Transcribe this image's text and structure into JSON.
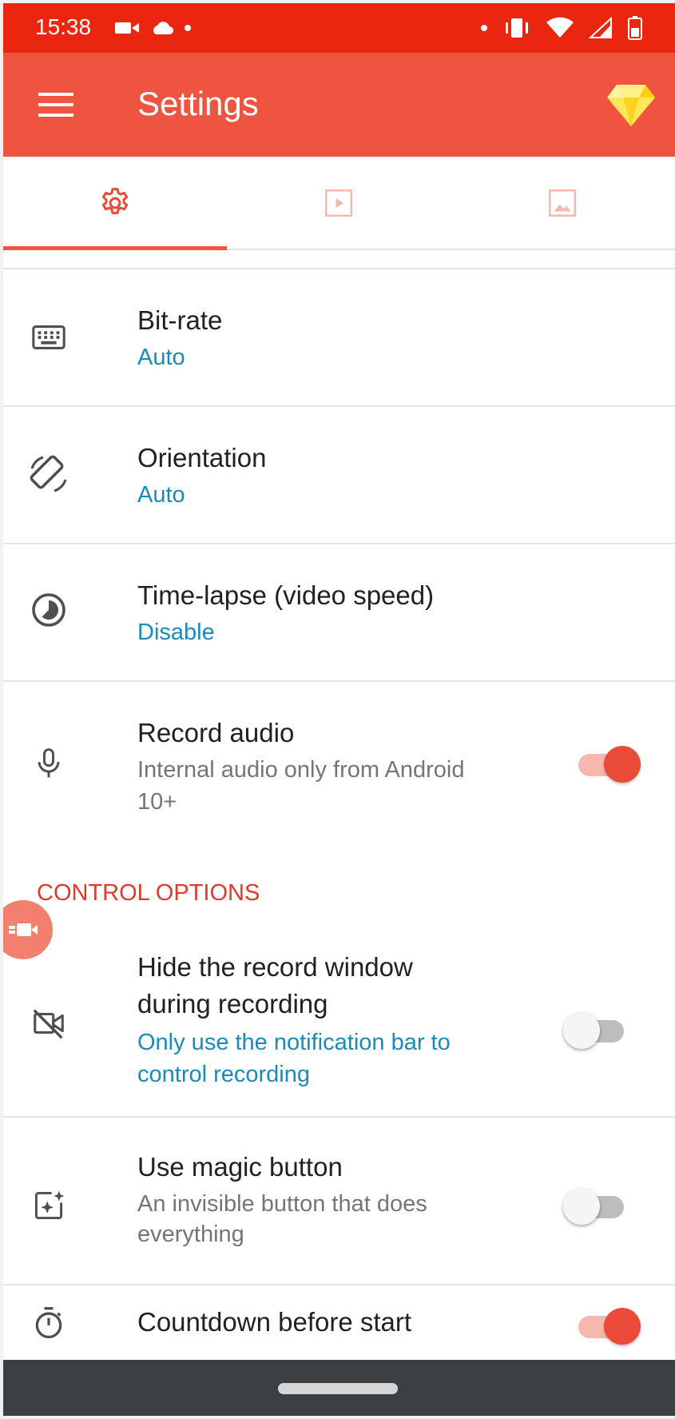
{
  "status_bar": {
    "time": "15:38",
    "left_icons": [
      "video-camera-icon",
      "cloud-icon",
      "dot-icon"
    ],
    "right_icons": [
      "dot-icon",
      "vibrate-icon",
      "wifi-icon",
      "signal-icon",
      "battery-icon"
    ]
  },
  "app_bar": {
    "title": "Settings",
    "menu_icon": "menu-icon",
    "premium_icon": "diamond-icon"
  },
  "tabs": [
    {
      "icon": "gear-icon",
      "active": true
    },
    {
      "icon": "video-icon",
      "active": false
    },
    {
      "icon": "image-icon",
      "active": false
    }
  ],
  "settings": {
    "bitrate": {
      "title": "Bit-rate",
      "value": "Auto",
      "icon": "keyboard-icon"
    },
    "orientation": {
      "title": "Orientation",
      "value": "Auto",
      "icon": "screen-rotation-icon"
    },
    "timelapse": {
      "title": "Time-lapse (video speed)",
      "value": "Disable",
      "icon": "timelapse-icon"
    },
    "record_audio": {
      "title": "Record audio",
      "subtitle_1": "Internal audio only from Android",
      "subtitle_2": "10+",
      "icon": "microphone-icon",
      "enabled": true
    }
  },
  "control_options": {
    "header": "CONTROL OPTIONS",
    "hide_window": {
      "title_1": "Hide the record window",
      "title_2": "during recording",
      "subtitle_1": "Only use the notification bar to",
      "subtitle_2": "control recording",
      "icon": "video-off-icon",
      "enabled": false
    },
    "magic_button": {
      "title": "Use magic button",
      "subtitle_1": "An invisible button that does",
      "subtitle_2": "everything",
      "icon": "sparkle-icon",
      "enabled": false
    },
    "countdown": {
      "title": "Countdown before start",
      "icon": "timer-icon",
      "enabled": true
    }
  },
  "colors": {
    "status_bar": "#ea2610",
    "app_bar": "#ef5440",
    "accent": "#ea4a37",
    "link_blue": "#1a8ab8",
    "section_header": "#e03a2b"
  }
}
